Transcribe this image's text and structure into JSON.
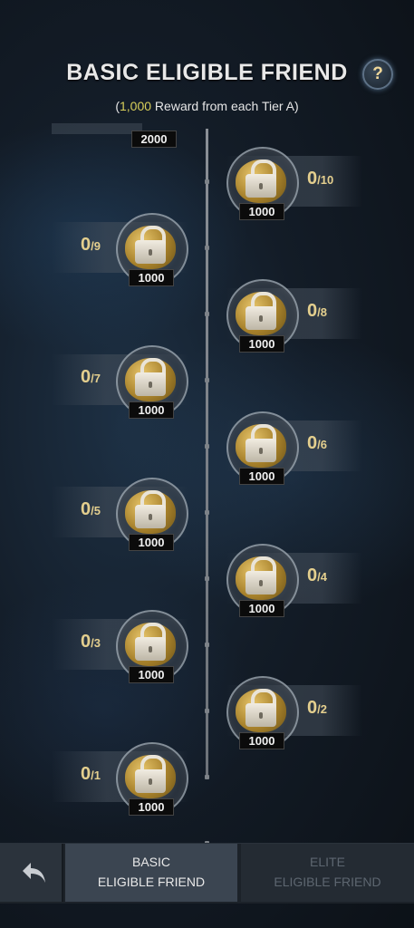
{
  "header": {
    "title": "BASIC ELIGIBLE FRIEND",
    "help_label": "?",
    "subtitle_prefix": "(",
    "subtitle_amount": "1,000",
    "subtitle_suffix": " Reward from each Tier A)"
  },
  "top_partial_reward": "2000",
  "tiers": [
    {
      "tier": 10,
      "current": "0",
      "sep": "/",
      "max": "10",
      "reward": "1000",
      "side": "right",
      "locked": true
    },
    {
      "tier": 9,
      "current": "0",
      "sep": "/",
      "max": "9",
      "reward": "1000",
      "side": "left",
      "locked": true
    },
    {
      "tier": 8,
      "current": "0",
      "sep": "/",
      "max": "8",
      "reward": "1000",
      "side": "right",
      "locked": true
    },
    {
      "tier": 7,
      "current": "0",
      "sep": "/",
      "max": "7",
      "reward": "1000",
      "side": "left",
      "locked": true
    },
    {
      "tier": 6,
      "current": "0",
      "sep": "/",
      "max": "6",
      "reward": "1000",
      "side": "right",
      "locked": true
    },
    {
      "tier": 5,
      "current": "0",
      "sep": "/",
      "max": "5",
      "reward": "1000",
      "side": "left",
      "locked": true
    },
    {
      "tier": 4,
      "current": "0",
      "sep": "/",
      "max": "4",
      "reward": "1000",
      "side": "right",
      "locked": true
    },
    {
      "tier": 3,
      "current": "0",
      "sep": "/",
      "max": "3",
      "reward": "1000",
      "side": "left",
      "locked": true
    },
    {
      "tier": 2,
      "current": "0",
      "sep": "/",
      "max": "2",
      "reward": "1000",
      "side": "right",
      "locked": true
    },
    {
      "tier": 1,
      "current": "0",
      "sep": "/",
      "max": "1",
      "reward": "1000",
      "side": "left",
      "locked": true
    }
  ],
  "bottom_tabs": {
    "back_icon": "back-arrow-icon",
    "basic_line1": "BASIC",
    "basic_line2": "ELIGIBLE FRIEND",
    "elite_line1": "ELITE",
    "elite_line2": "ELIGIBLE FRIEND"
  },
  "colors": {
    "accent_gold": "#e4cf8e",
    "amount_yellow": "#d8cf5a"
  }
}
